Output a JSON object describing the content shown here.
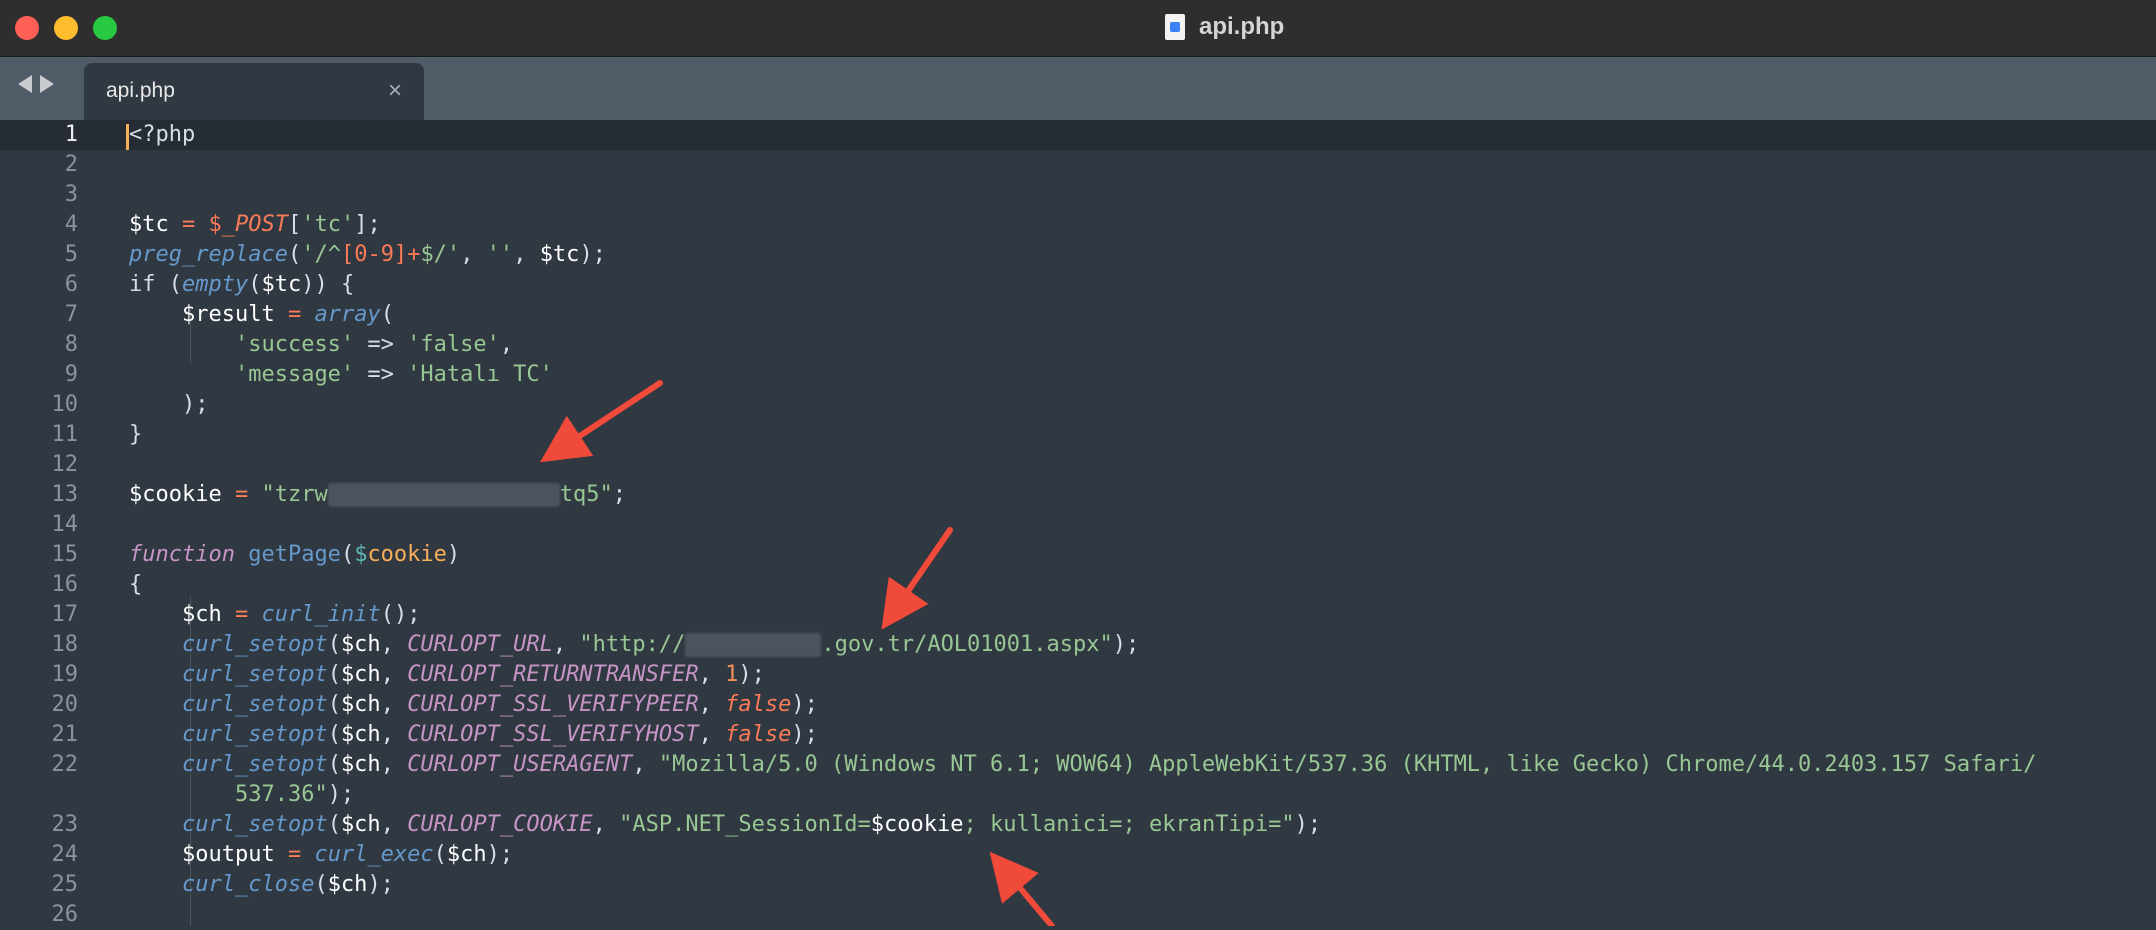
{
  "window": {
    "title": "api.php"
  },
  "tabbar": {
    "tab_label": "api.php",
    "close_glyph": "×"
  },
  "icons": {
    "file": "php-file-icon",
    "back": "back-arrow-icon",
    "forward": "forward-arrow-icon",
    "close": "close-icon",
    "annotation": "red-arrow-icon"
  },
  "colors": {
    "background": "#303841",
    "accent_cursor": "#f9ae58",
    "annotation_arrow": "#f04a3a"
  },
  "editor": {
    "line_numbers": [
      "1",
      "2",
      "3",
      "4",
      "5",
      "6",
      "7",
      "8",
      "9",
      "10",
      "11",
      "12",
      "13",
      "14",
      "15",
      "16",
      "17",
      "18",
      "19",
      "",
      "20",
      "21",
      "22",
      "",
      "23",
      "24",
      "25",
      "26"
    ],
    "lines": [
      {
        "n": "1"
      },
      {
        "n": "2"
      },
      {
        "n": "3"
      }
    ],
    "t": {
      "l1": "<?php",
      "l4_a": "$tc",
      "l4_b": " = ",
      "l4_c": "$",
      "l4_d": "_POST",
      "l4_e": "[",
      "l4_f": "'tc'",
      "l4_g": "];",
      "l5_a": "preg_replace",
      "l5_b": "(",
      "l5_c": "'/^",
      "l5_d": "[0-9]",
      "l5_e": "+",
      "l5_f": "$/'",
      "l5_g": ", ",
      "l5_h": "''",
      "l5_i": ", ",
      "l5_j": "$tc",
      "l5_k": ");",
      "l6_a": "if (",
      "l6_b": "empty",
      "l6_c": "(",
      "l6_d": "$tc",
      "l6_e": ")) {",
      "l7_a": "$result",
      "l7_b": " = ",
      "l7_c": "array",
      "l7_d": "(",
      "l8_a": "'success'",
      "l8_b": " => ",
      "l8_c": "'false'",
      "l8_d": ",",
      "l9_a": "'message'",
      "l9_b": " => ",
      "l9_c": "'Hatalı TC'",
      "l10": ");",
      "l11": "}",
      "l13_a": "$cookie",
      "l13_b": " = ",
      "l13_c": "\"tzrw",
      "l13_d": "tq5\"",
      "l13_e": ";",
      "l15_a": "function",
      "l15_b": " getPage",
      "l15_c": "(",
      "l15_d": "$",
      "l15_e": "cookie",
      "l15_f": ")",
      "l16": "{",
      "l17_a": "$ch",
      "l17_b": " = ",
      "l17_c": "curl_init",
      "l17_d": "();",
      "l18_a": "curl_setopt",
      "l18_b": "(",
      "l18_c": "$ch",
      "l18_d": ", ",
      "l18_e": "CURLOPT_URL",
      "l18_f": ", ",
      "l18_g": "\"http://",
      "l18_h": ".gov.tr/AOL01001.aspx\"",
      "l18_i": ");",
      "l19_e": "CURLOPT_RETURNTRANSFER",
      "l19_g": "1",
      "l19_i": ");",
      "l20_e": "CURLOPT_SSL_VERIFYPEER",
      "l20_g": "false",
      "l20_i": ");",
      "l21_e": "CURLOPT_SSL_VERIFYHOST",
      "l21_g": "false",
      "l21_i": ");",
      "l22_e": "CURLOPT_USERAGENT",
      "l22_g": "\"Mozilla/5.0 (Windows NT 6.1; WOW64) AppleWebKit/537.36 (KHTML, like Gecko) Chrome/44.0.2403.157 Safari/",
      "l22b": "537.36\"",
      "l22b_i": ");",
      "l23_e": "CURLOPT_COOKIE",
      "l23_g": "\"ASP.NET_SessionId=",
      "l23_h": "$",
      "l23_j": "cookie",
      "l23_k": "; kullanici=; ekranTipi=\"",
      "l23_i": ");",
      "l24_a": "$output",
      "l24_b": " = ",
      "l24_c": "curl_exec",
      "l24_d": "(",
      "l24_e": "$ch",
      "l24_f": ");",
      "l25_a": "curl_close",
      "l25_b": "(",
      "l25_c": "$ch",
      "l25_d": ");"
    }
  }
}
